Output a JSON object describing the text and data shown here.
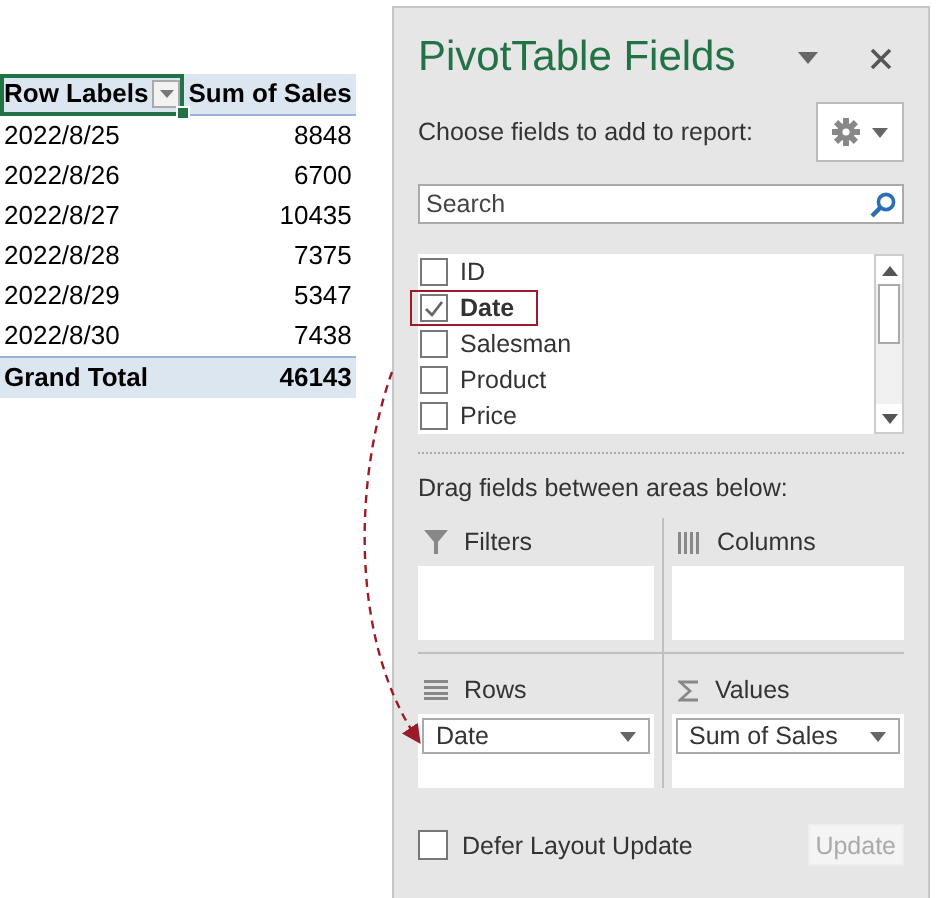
{
  "pivot_table": {
    "columns": [
      "Row Labels",
      "Sum of Sales"
    ],
    "rows": [
      {
        "label": "2022/8/25",
        "value": "8848"
      },
      {
        "label": "2022/8/26",
        "value": "6700"
      },
      {
        "label": "2022/8/27",
        "value": "10435"
      },
      {
        "label": "2022/8/28",
        "value": "7375"
      },
      {
        "label": "2022/8/29",
        "value": "5347"
      },
      {
        "label": "2022/8/30",
        "value": "7438"
      }
    ],
    "total": {
      "label": "Grand Total",
      "value": "46143"
    }
  },
  "panel": {
    "title": "PivotTable Fields",
    "choose_label": "Choose fields to add to report:",
    "search": {
      "placeholder": "Search"
    },
    "fields": [
      {
        "name": "ID",
        "checked": false,
        "highlighted": false
      },
      {
        "name": "Date",
        "checked": true,
        "highlighted": true
      },
      {
        "name": "Salesman",
        "checked": false,
        "highlighted": false
      },
      {
        "name": "Product",
        "checked": false,
        "highlighted": false
      },
      {
        "name": "Price",
        "checked": false,
        "highlighted": false
      }
    ],
    "drag_label": "Drag fields between areas below:",
    "areas": [
      {
        "kind": "filters",
        "label": "Filters"
      },
      {
        "kind": "columns",
        "label": "Columns"
      },
      {
        "kind": "rows",
        "label": "Rows",
        "items": [
          "Date"
        ]
      },
      {
        "kind": "values",
        "label": "Values",
        "items": [
          "Sum of Sales"
        ]
      }
    ],
    "defer": {
      "label": "Defer Layout Update",
      "checked": false
    },
    "update_button": {
      "label": "Update",
      "disabled": true
    }
  }
}
